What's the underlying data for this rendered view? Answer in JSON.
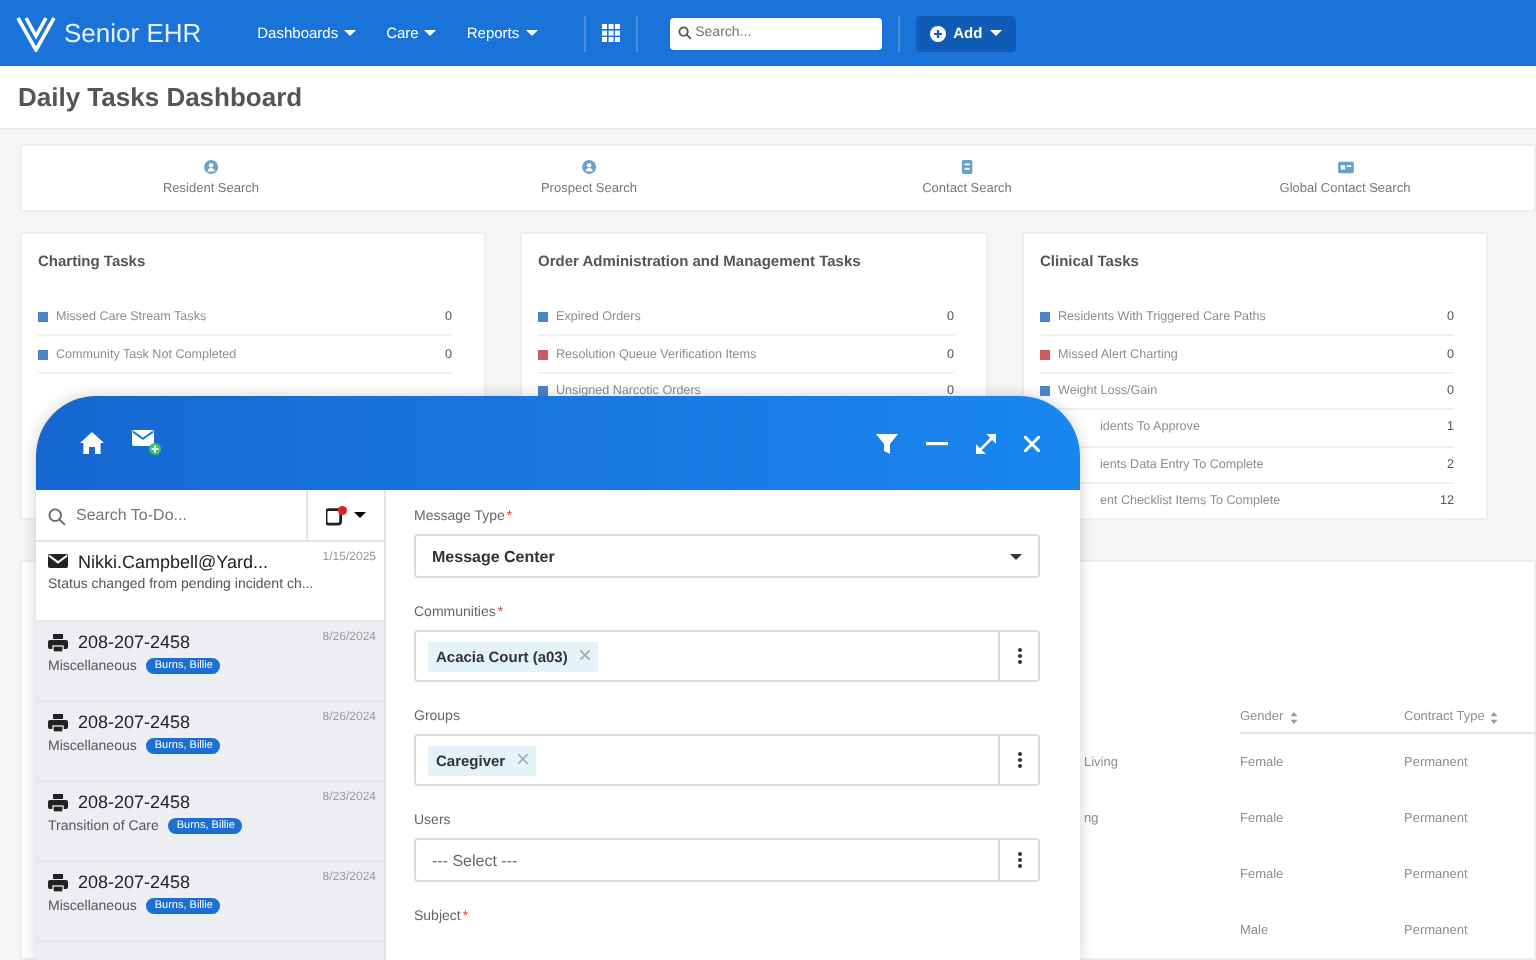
{
  "navbar": {
    "brand": "Senior EHR",
    "menus": [
      {
        "label": "Dashboards"
      },
      {
        "label": "Care"
      },
      {
        "label": "Reports"
      }
    ],
    "search": {
      "placeholder": "Search..."
    },
    "add_button": "Add"
  },
  "page_title": "Daily Tasks Dashboard",
  "quick_searches": [
    {
      "label": "Resident Search",
      "kind": "person"
    },
    {
      "label": "Prospect Search",
      "kind": "person"
    },
    {
      "label": "Contact Search",
      "kind": "contact"
    },
    {
      "label": "Global Contact Search",
      "kind": "card"
    }
  ],
  "task_cards": [
    {
      "title": "Charting Tasks",
      "items": [
        {
          "kind": "full",
          "label": "Missed Care Stream Tasks",
          "count": "0",
          "color": "#4a86c5"
        },
        {
          "kind": "full",
          "label": "Community Task Not Completed",
          "count": "0",
          "color": "#4a86c5"
        }
      ]
    },
    {
      "title": "Order Administration and Management Tasks",
      "items": [
        {
          "kind": "full",
          "label": "Expired Orders",
          "count": "0",
          "color": "#4a86c5"
        },
        {
          "kind": "full",
          "label": "Resolution Queue Verification Items",
          "count": "0",
          "color": "#d05a5a"
        },
        {
          "kind": "full",
          "label": "Unsigned Narcotic Orders",
          "count": "0",
          "color": "#4a86c5"
        }
      ]
    },
    {
      "title": "Clinical Tasks",
      "items": [
        {
          "kind": "full",
          "label": "Residents With Triggered Care Paths",
          "count": "0",
          "color": "#4a86c5"
        },
        {
          "kind": "full",
          "label": "Missed Alert Charting",
          "count": "0",
          "color": "#d05a5a"
        },
        {
          "kind": "full",
          "label": "Weight Loss/Gain",
          "count": "0",
          "color": "#4a86c5"
        },
        {
          "kind": "partial",
          "label": "idents To Approve",
          "count": "1"
        },
        {
          "kind": "partial",
          "label": "ients Data Entry To Complete",
          "count": "2"
        },
        {
          "kind": "partial",
          "label": "ent Checklist Items To Complete",
          "count": "12"
        }
      ]
    }
  ],
  "table": {
    "columns": [
      {
        "label": "Gender"
      },
      {
        "label": "Contract Type"
      }
    ],
    "rows": [
      {
        "column_1": "Living",
        "gender": "Female",
        "contract_type": "Permanent"
      },
      {
        "column_1": "ng",
        "gender": "Female",
        "contract_type": "Permanent"
      },
      {
        "gender": "Female",
        "contract_type": "Permanent"
      },
      {
        "gender": "Male",
        "contract_type": "Permanent"
      }
    ]
  },
  "todo_panel": {
    "search": {
      "placeholder": "Search To-Do..."
    },
    "items": [
      {
        "kind": "mail",
        "title": "Nikki.Campbell@Yard...",
        "date": "1/15/2025",
        "subtitle": "Status changed from pending incident ch...",
        "selected": true
      },
      {
        "kind": "printer",
        "title": "208-207-2458",
        "date": "8/26/2024",
        "subtitle": "Miscellaneous",
        "badge": "Burns, Billie",
        "selected": false
      },
      {
        "kind": "printer",
        "title": "208-207-2458",
        "date": "8/26/2024",
        "subtitle": "Miscellaneous",
        "badge": "Burns, Billie",
        "selected": false
      },
      {
        "kind": "printer",
        "title": "208-207-2458",
        "date": "8/23/2024",
        "subtitle": "Transition of Care",
        "badge": "Burns, Billie",
        "selected": false
      },
      {
        "kind": "printer",
        "title": "208-207-2458",
        "date": "8/23/2024",
        "subtitle": "Miscellaneous",
        "badge": "Burns, Billie",
        "selected": false
      }
    ],
    "form": [
      {
        "kind": "select",
        "label": "Message Type",
        "required_mark": "*",
        "value": "Message Center"
      },
      {
        "kind": "tags",
        "label": "Communities",
        "required_mark": "*",
        "tags": [
          "Acacia Court (a03)"
        ]
      },
      {
        "kind": "tags",
        "label": "Groups",
        "tags": [
          "Caregiver"
        ]
      },
      {
        "kind": "picker",
        "label": "Users",
        "placeholder": "--- Select ---"
      },
      {
        "kind": "label",
        "label": "Subject",
        "required_mark": "*"
      }
    ]
  }
}
